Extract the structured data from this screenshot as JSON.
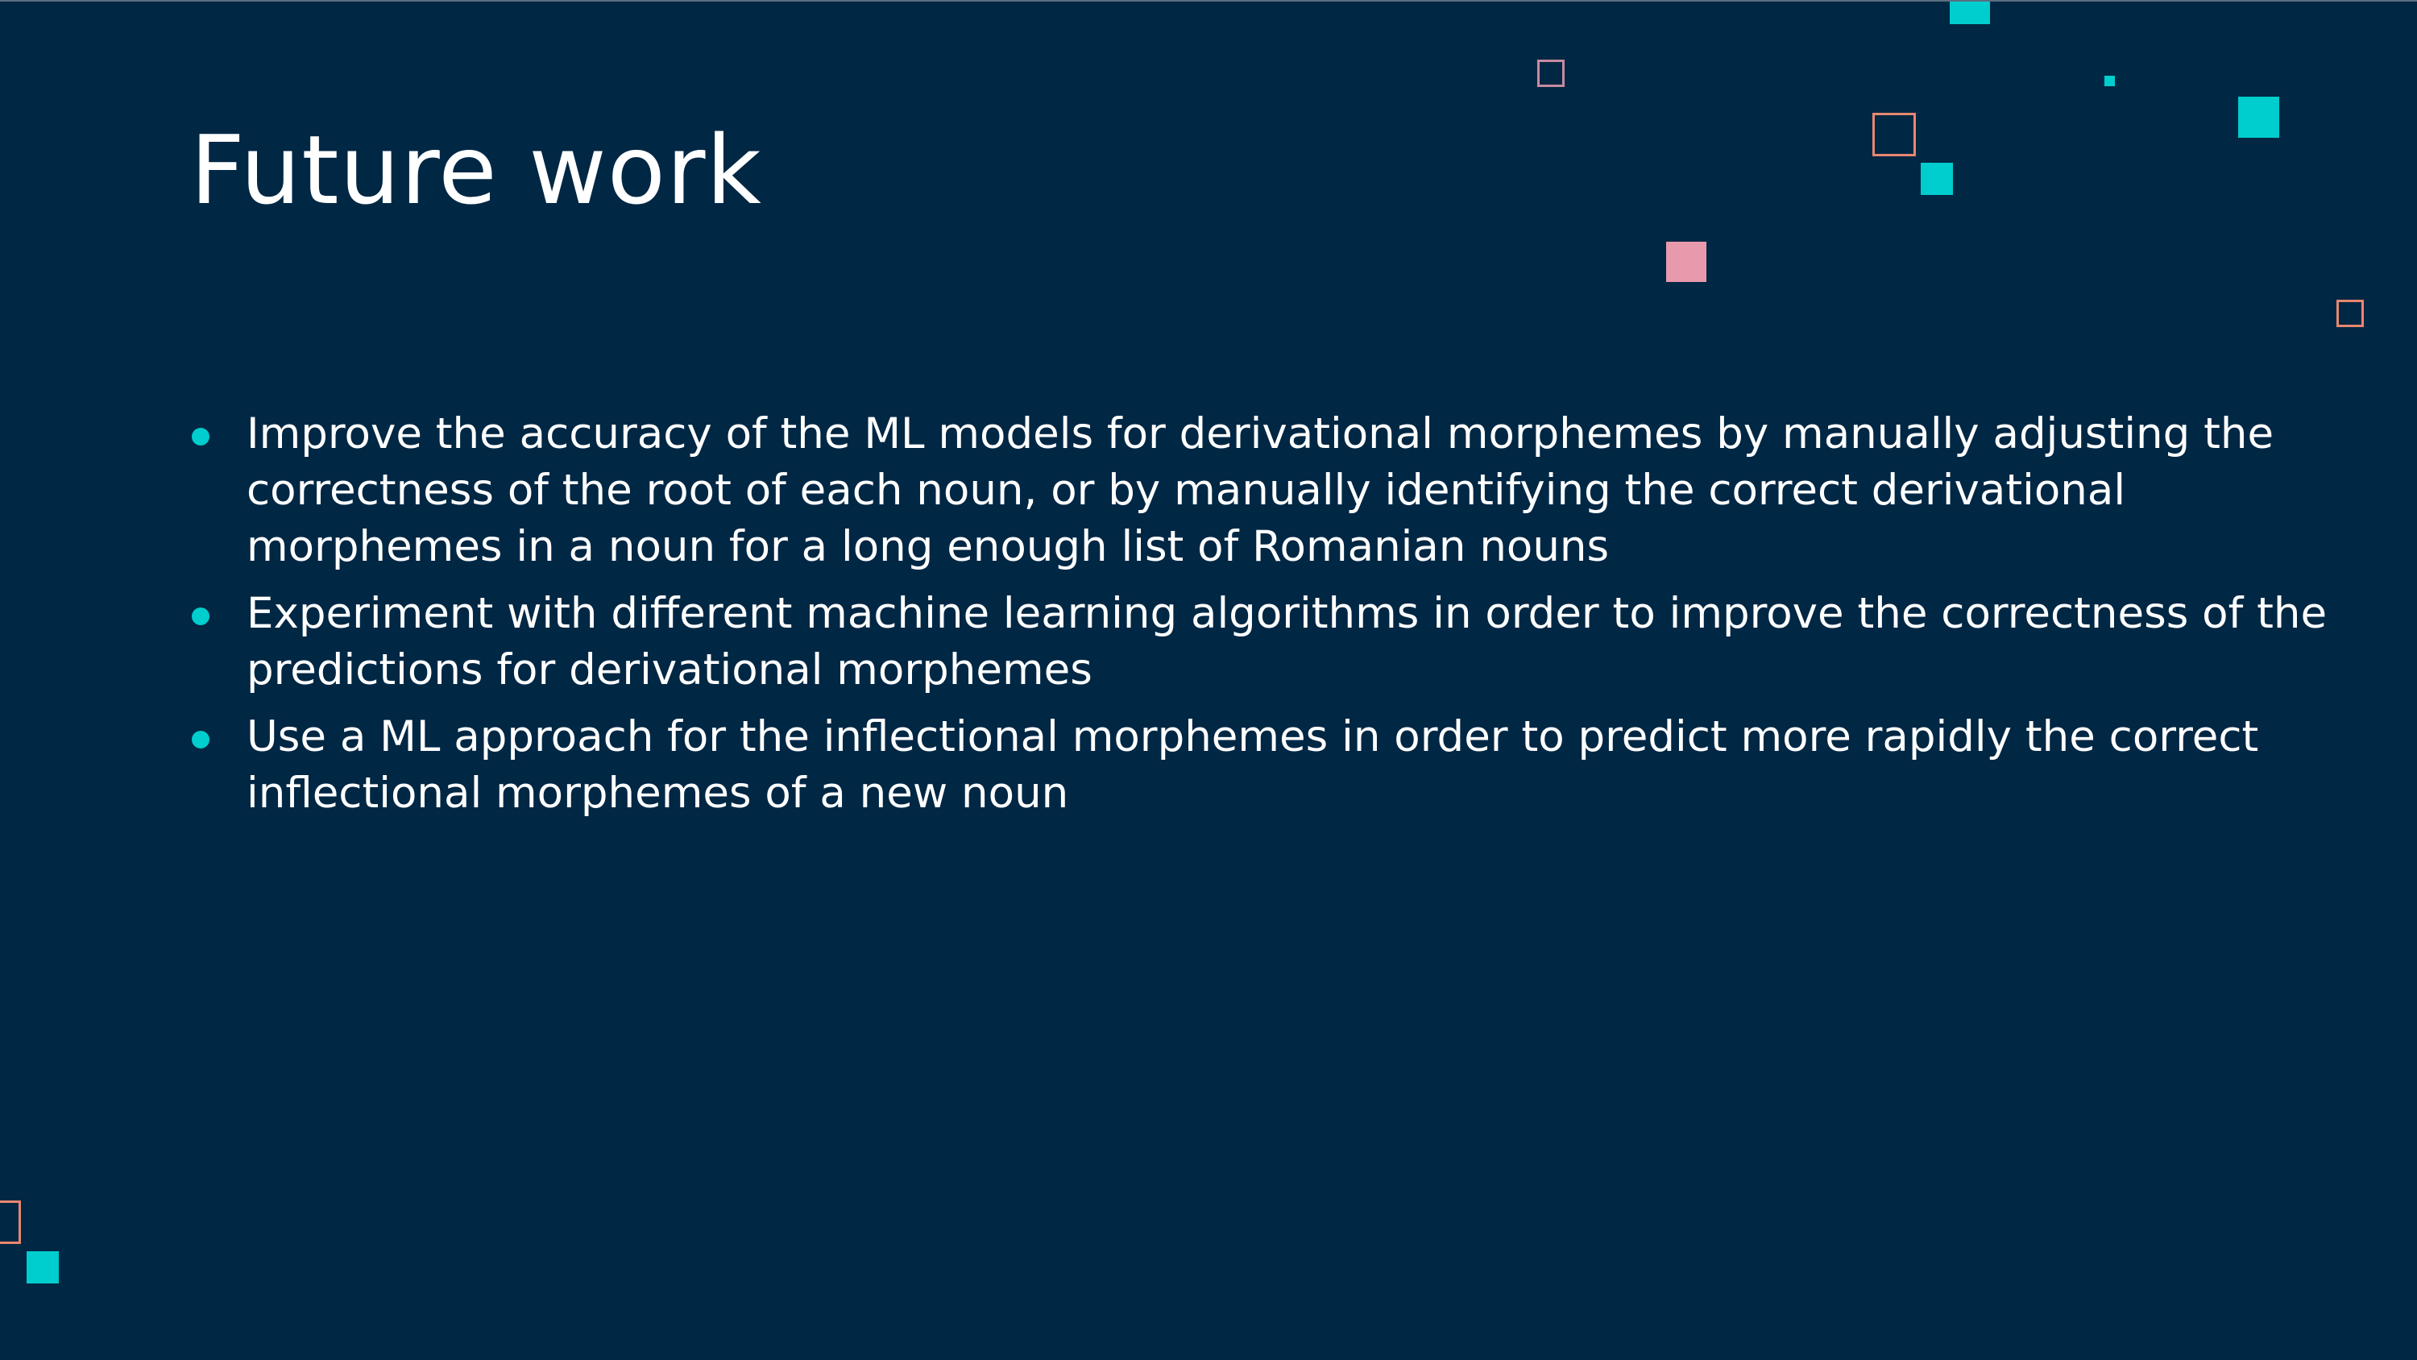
{
  "colors": {
    "background": "#002744",
    "title_text": "#ffffff",
    "body_text": "#ffffff",
    "bullet": "#00cdcd",
    "teal": "#00cdcd",
    "pink": "#e899ab",
    "salmon_outline": "#e8876f",
    "mauve_outline": "#c88aa0"
  },
  "slide": {
    "title": "Future work",
    "bullets": [
      {
        "text": "Improve the accuracy of the ML models for derivational morphemes by manually adjusting the correctness of the root of each noun, or by manually identifying the correct derivational morphemes in a noun for a long enough list of Romanian nouns"
      },
      {
        "text": "Experiment with different machine learning algorithms in order to improve the correctness of the predictions for derivational morphemes"
      },
      {
        "text": "Use a ML approach for the inflectional morphemes in order to predict more rapidly the correct inflectional morphemes of a new noun"
      }
    ]
  }
}
